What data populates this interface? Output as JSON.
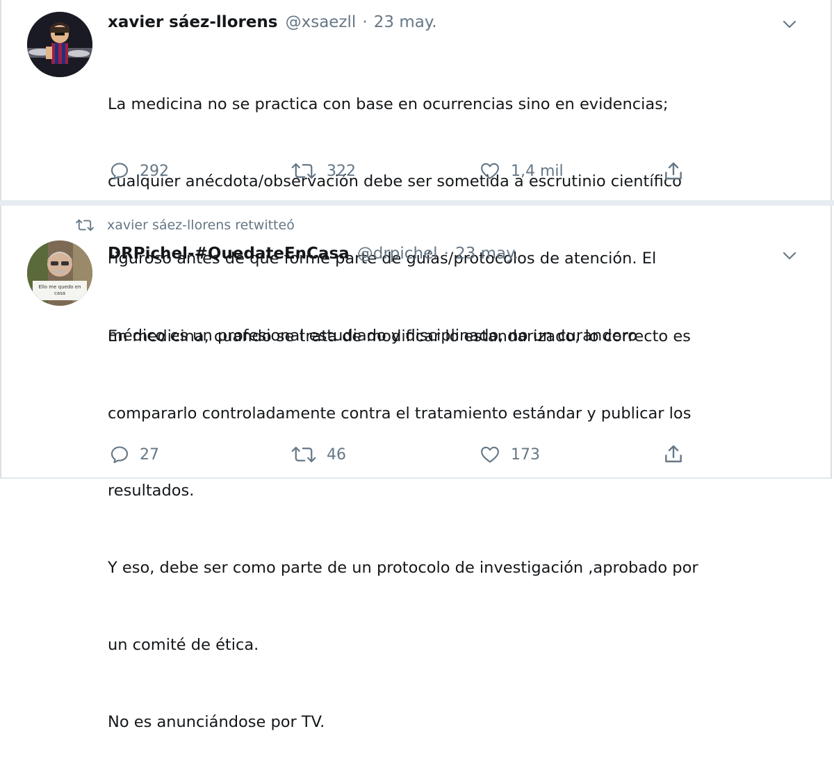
{
  "tweets": [
    {
      "author_name": "xavier sáez-llorens",
      "handle": "@xsaezll",
      "separator": "·",
      "date": "23 may.",
      "lines": [
        "La medicina no se practica con base en ocurrencias sino en evidencias;",
        "cualquier anécdota/observación debe ser sometida a escrutinio científico",
        "riguroso antes de que forme parte de guías/protocolos de atención. El",
        "médico es un profesional estudiado y disciplinado, no un curandero"
      ],
      "replies": "292",
      "retweets": "322",
      "likes": "1,4 mil"
    },
    {
      "retweet_label": "xavier sáez-llorens retwitteó",
      "author_name": "DRPichel-#QuedateEnCasa",
      "handle": "@drpichel",
      "separator": "·",
      "date": "23 may.",
      "lines": [
        "En medicina, cuando se trata de modificar lo estandarizado, lo correcto es",
        "compararlo controladamente contra el tratamiento estándar y publicar los",
        "resultados.",
        "Y eso, debe ser como parte de un protocolo de investigación ,aprobado por",
        "un comité de ética.",
        "No es anunciándose por TV."
      ],
      "replies": "27",
      "retweets": "46",
      "likes": "173",
      "avatar_sign_text": "Ello me quedo en casa"
    }
  ],
  "icons": {
    "reply": "reply-icon",
    "retweet": "retweet-icon",
    "like": "heart-icon",
    "share": "share-icon",
    "caret": "chevron-down-icon"
  },
  "colors": {
    "text": "#14171a",
    "secondary": "#657786",
    "divider": "#e6ecf0"
  }
}
